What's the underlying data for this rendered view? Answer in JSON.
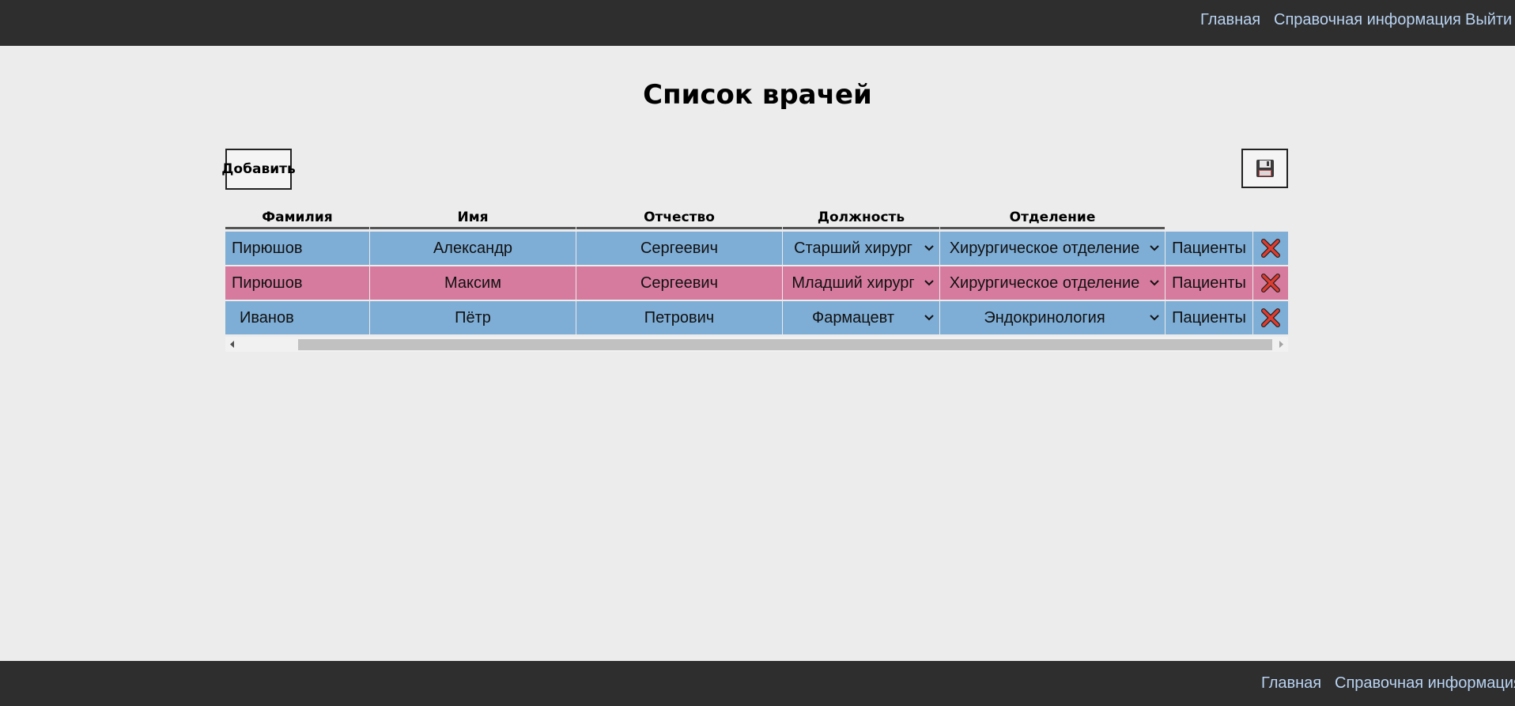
{
  "nav_top": {
    "links": [
      "Главная",
      "Справочная информация",
      "Выйти"
    ]
  },
  "page_title": "Список врачей",
  "toolbar": {
    "add_label": "Добавить",
    "save_icon": "floppy-disk-icon"
  },
  "table": {
    "headers": [
      "Фамилия",
      "Имя",
      "Отчество",
      "Должность",
      "Отделение"
    ],
    "rows": [
      {
        "surname": "Пирюшов",
        "name": "Александр",
        "patronymic": "Сергеевич",
        "position": "Старший хирург",
        "department": "Хирургическое отделение",
        "patients_label": "Пациенты",
        "color": "#7eadd5"
      },
      {
        "surname": "Пирюшов",
        "name": "Максим",
        "patronymic": "Сергеевич",
        "position": "Младший хирург",
        "department": "Хирургическое отделение",
        "patients_label": "Пациенты",
        "color": "#d67b9e"
      },
      {
        "surname": "Иванов",
        "name": "Пётр",
        "patronymic": "Петрович",
        "position": "Фармацевт",
        "department": "Эндокринология",
        "patients_label": "Пациенты",
        "color": "#7eadd5"
      }
    ]
  },
  "nav_bottom": {
    "links": [
      "Главная",
      "Справочная информация"
    ]
  },
  "colors": {
    "bar_bg": "#2e2e2e",
    "link": "#b9d3f2",
    "page_bg": "#ececec",
    "row_blue": "#7eadd5",
    "row_pink": "#d67b9e",
    "delete_red": "#e23b2e"
  }
}
